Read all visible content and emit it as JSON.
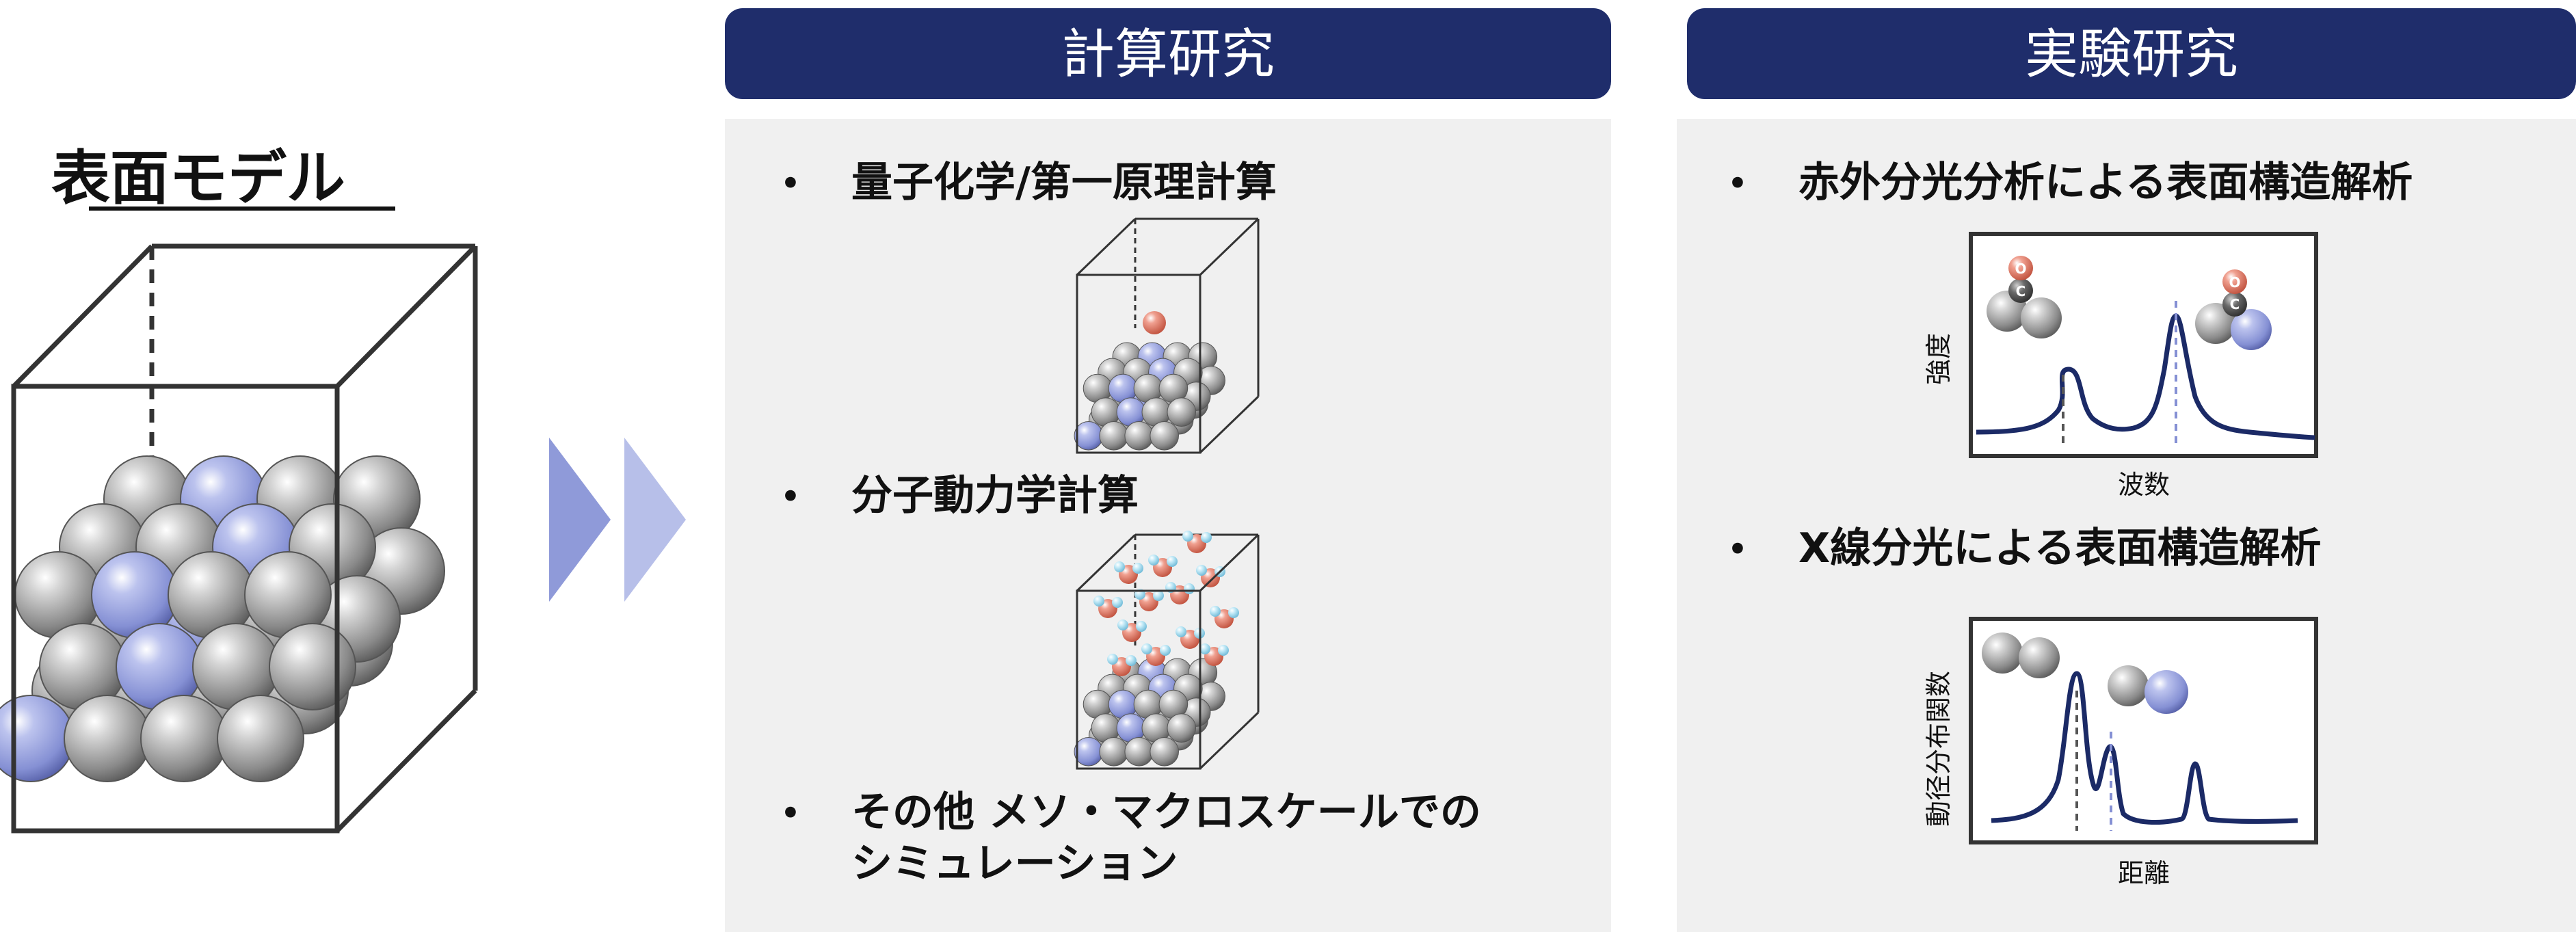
{
  "surface_model": {
    "title": "表面モデル"
  },
  "computational": {
    "header": "計算研究",
    "header_color": "#1f2d6b",
    "panel_color": "#f0f0f0",
    "items": [
      {
        "label": "量子化学/第一原理計算"
      },
      {
        "label": "分子動力学計算"
      },
      {
        "label_line1": "その他 メソ・マクロスケールでの",
        "label_line2": "シミュレーション"
      }
    ]
  },
  "experimental": {
    "header": "実験研究",
    "header_color": "#1f2d6b",
    "panel_color": "#f0f0f0",
    "items": [
      {
        "label": "赤外分光分析による表面構造解析",
        "chart": {
          "ylabel": "強度",
          "xlabel": "波数"
        }
      },
      {
        "label": "X線分光による表面構造解析",
        "chart": {
          "ylabel": "動径分布関数",
          "xlabel": "距離"
        }
      }
    ]
  },
  "bullet": "•",
  "molecule_labels": {
    "oxygen": "O",
    "carbon": "C"
  },
  "colors": {
    "grey_atom": "#9a9a9a",
    "blue_atom": "#8e98d8",
    "arrow_dark": "#8f9ad9",
    "arrow_light": "#b7bfe9",
    "curve": "#1b2a66",
    "oxygen": "#e07060",
    "hydrogen": "#a9def0"
  }
}
